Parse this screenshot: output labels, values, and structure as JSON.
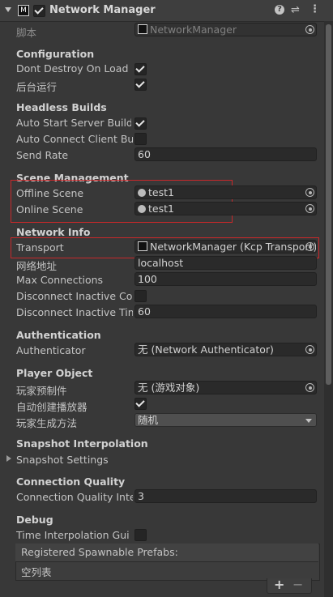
{
  "header": {
    "title": "Network Manager",
    "enabled": true
  },
  "script": {
    "label": "脚本",
    "value": "NetworkManager"
  },
  "configuration": {
    "section": "Configuration",
    "dont_destroy_label": "Dont Destroy On Load",
    "dont_destroy": true,
    "run_in_background_label": "后台运行",
    "run_in_background": true
  },
  "headless": {
    "section": "Headless Builds",
    "auto_start_label": "Auto Start Server Build",
    "auto_start": true,
    "auto_connect_label": "Auto Connect Client Build",
    "auto_connect": false,
    "send_rate_label": "Send Rate",
    "send_rate": "60"
  },
  "scene": {
    "section": "Scene Management",
    "offline_label": "Offline Scene",
    "offline_value": "test1",
    "online_label": "Online Scene",
    "online_value": "test1"
  },
  "network": {
    "section": "Network Info",
    "transport_label": "Transport",
    "transport_value": "NetworkManager (Kcp Transport)",
    "address_label": "网络地址",
    "address_value": "localhost",
    "max_conn_label": "Max Connections",
    "max_conn_value": "100",
    "disconnect_inactive_label": "Disconnect Inactive Connections",
    "disconnect_inactive": false,
    "disconnect_timeout_label": "Disconnect Inactive Timeout",
    "disconnect_timeout_value": "60"
  },
  "authentication": {
    "section": "Authentication",
    "authenticator_label": "Authenticator",
    "authenticator_value": "无 (Network Authenticator)"
  },
  "player": {
    "section": "Player Object",
    "prefab_label": "玩家预制件",
    "prefab_value": "无 (游戏对象)",
    "auto_create_label": "自动创建播放器",
    "auto_create": true,
    "spawn_method_label": "玩家生成方法",
    "spawn_method_value": "随机"
  },
  "snapshot": {
    "section": "Snapshot Interpolation",
    "settings_label": "Snapshot Settings"
  },
  "quality": {
    "section": "Connection Quality",
    "interval_label": "Connection Quality Interval",
    "interval_value": "3"
  },
  "debug": {
    "section": "Debug",
    "time_gui_label": "Time Interpolation Gui",
    "time_gui": false,
    "prefabs_header": "Registered Spawnable Prefabs:",
    "prefabs_empty": "空列表",
    "add": "+",
    "remove": "−"
  }
}
